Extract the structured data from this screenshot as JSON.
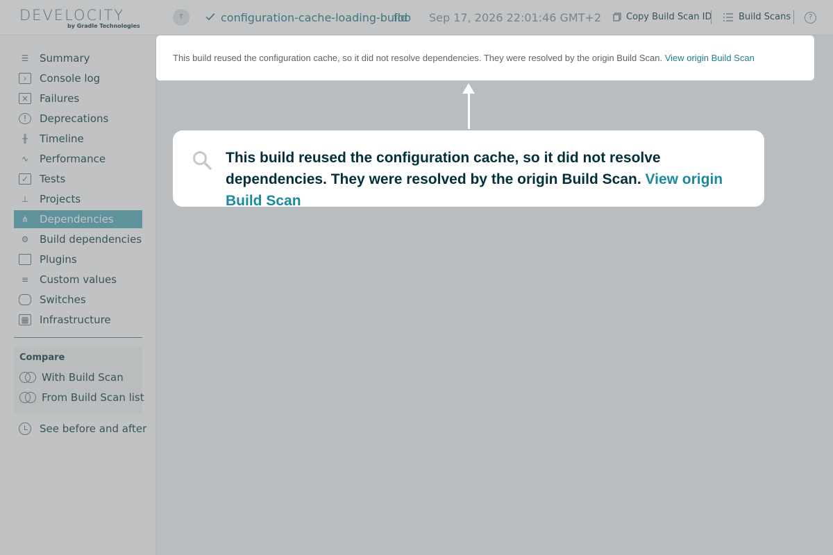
{
  "header": {
    "logo_text": "DEVELOCITY",
    "logo_subtitle": "by Gradle Technologies",
    "avatar_initial": "T",
    "build_name": "configuration-cache-loading-build",
    "build_tag": "foo",
    "build_date": "Sep 17, 2026 22:01:46 GMT+2",
    "copy_id_label": "Copy Build Scan ID",
    "build_scans_label": "Build Scans",
    "help_glyph": "?"
  },
  "sidebar": {
    "items": [
      {
        "label": "Summary",
        "icon": "list-icon"
      },
      {
        "label": "Console log",
        "icon": "terminal-icon"
      },
      {
        "label": "Failures",
        "icon": "failure-icon"
      },
      {
        "label": "Deprecations",
        "icon": "warning-icon"
      },
      {
        "label": "Timeline",
        "icon": "timeline-icon"
      },
      {
        "label": "Performance",
        "icon": "performance-icon"
      },
      {
        "label": "Tests",
        "icon": "tests-icon"
      },
      {
        "label": "Projects",
        "icon": "projects-icon"
      },
      {
        "label": "Dependencies",
        "icon": "dependencies-icon",
        "active": true
      },
      {
        "label": "Build dependencies",
        "icon": "build-dependencies-icon"
      },
      {
        "label": "Plugins",
        "icon": "plugin-icon"
      },
      {
        "label": "Custom values",
        "icon": "custom-values-icon"
      },
      {
        "label": "Switches",
        "icon": "switches-icon"
      },
      {
        "label": "Infrastructure",
        "icon": "infrastructure-icon"
      }
    ],
    "compare_title": "Compare",
    "compare_with": "With Build Scan",
    "compare_from": "From Build Scan list",
    "before_after": "See before and after"
  },
  "notice": {
    "text": "This build reused the configuration cache, so it did not resolve dependencies. They were resolved by the origin Build Scan. ",
    "link": "View origin Build Scan"
  },
  "zoom": {
    "text": "This build reused the configuration cache, so it did not resolve dependencies. They were resolved by the origin Build Scan. ",
    "link": "View origin Build Scan"
  },
  "colors": {
    "accent": "#4aa7b5",
    "link": "#1a7f91",
    "text": "#02303a"
  }
}
